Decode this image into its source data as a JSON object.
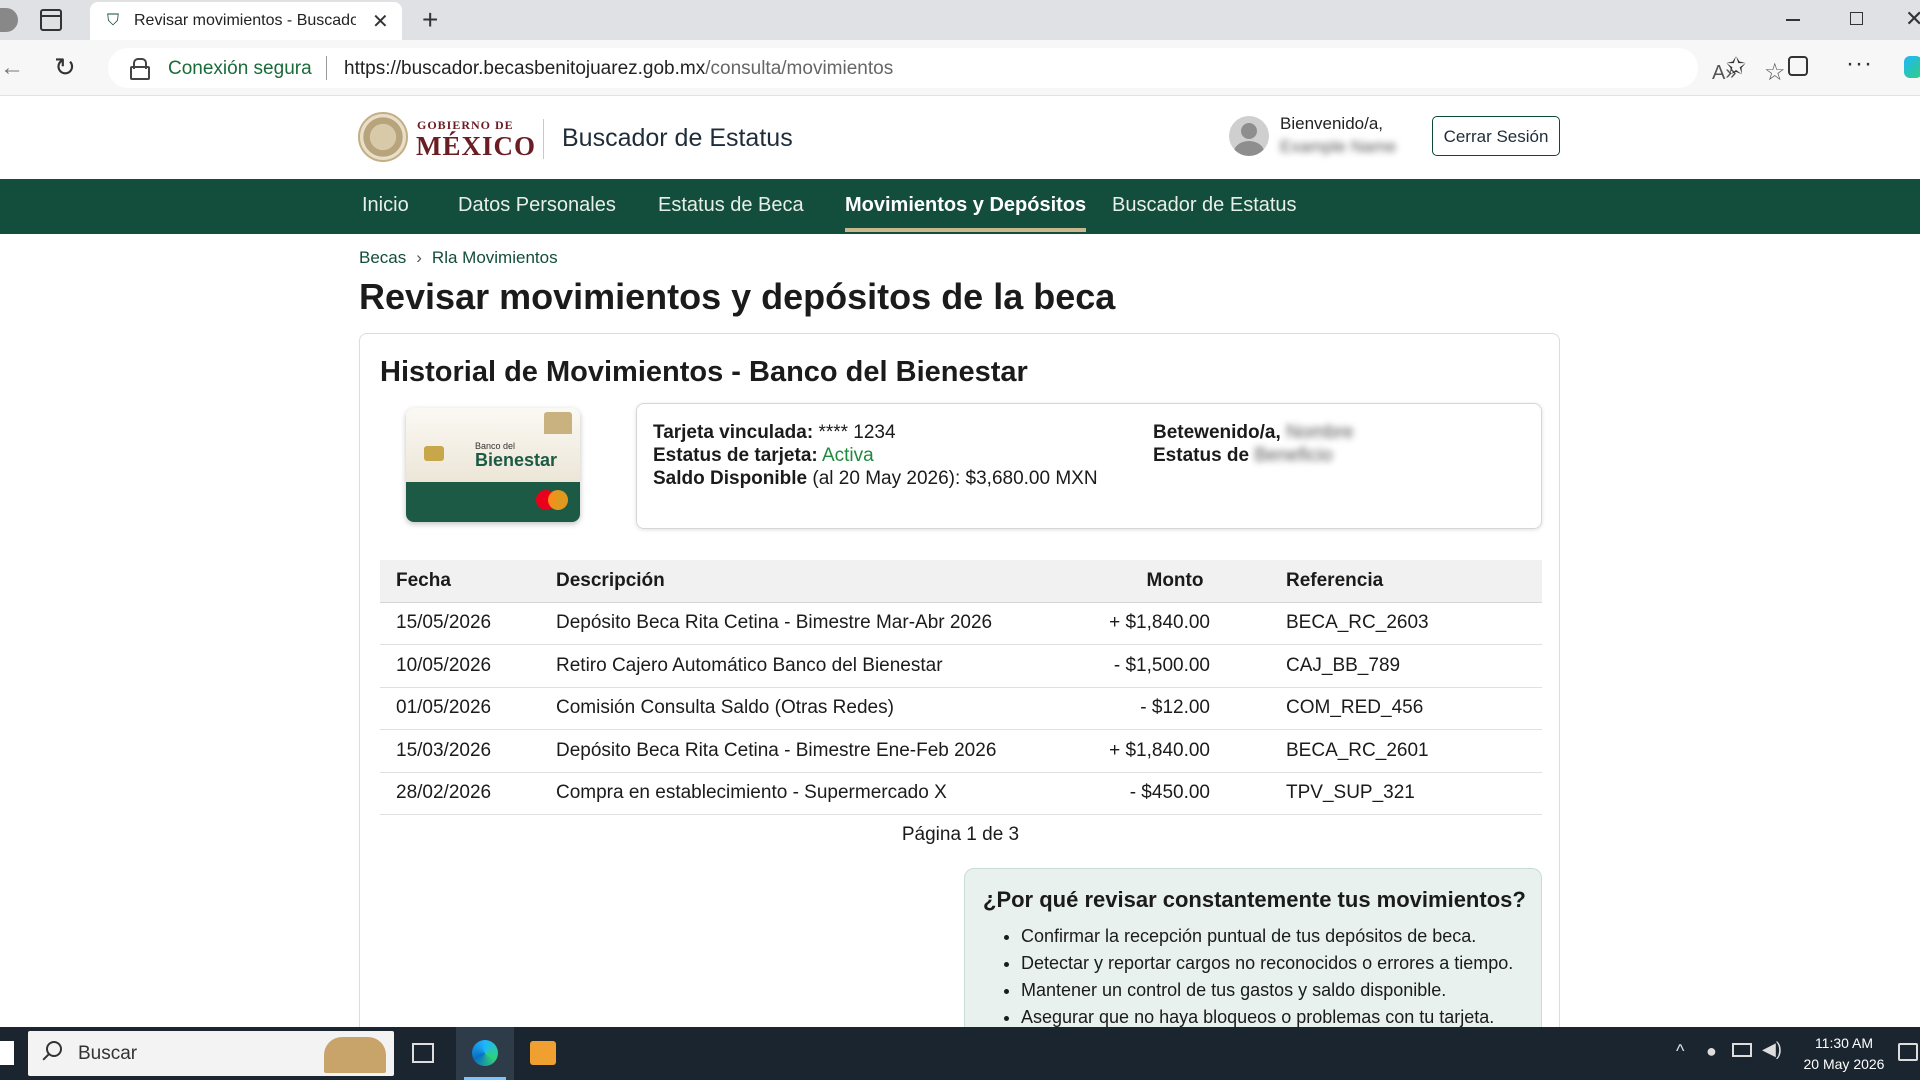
{
  "browser": {
    "tab_title": "Revisar movimientos - Buscador de Estatus",
    "secure_label": "Conexión segura",
    "url_host": "https://buscador.becasbenitojuarez.gob.mx",
    "url_path": "/consulta/movimientos"
  },
  "header": {
    "logo_small": "GOBIERNO DE",
    "logo_big": "MÉXICO",
    "site_title": "Buscador de Estatus",
    "welcome_label": "Bienvenido/a,",
    "welcome_name": "Example Name",
    "logout_label": "Cerrar Sesión"
  },
  "nav": {
    "items": [
      {
        "label": "Inicio"
      },
      {
        "label": "Datos Personales"
      },
      {
        "label": "Estatus de Beca"
      },
      {
        "label": "Movimientos y Depósitos",
        "active": true
      },
      {
        "label": "Buscador de Estatus"
      }
    ]
  },
  "breadcrumb": {
    "items": [
      "Becas",
      "Rla Movimientos"
    ],
    "separator": "›"
  },
  "page": {
    "title": "Revisar movimientos y depósitos de la beca"
  },
  "history": {
    "title": "Historial de Movimientos - Banco del Bienestar",
    "card_image": {
      "small_text": "Banco del",
      "name": "Bienestar"
    },
    "info": {
      "card_label": "Tarjeta vinculada:",
      "card_value": "**** 1234",
      "status_label": "Estatus de tarjeta:",
      "status_value": "Activa",
      "balance_label": "Saldo Disponible",
      "balance_value": "(al 20 May 2026): $3,680.00 MXN",
      "welcome_label": "Betewenido/a,",
      "welcome_value": "Nombre",
      "beca_status_label": "Estatus de",
      "beca_status_value": "Beneficio"
    },
    "table": {
      "headers": [
        "Fecha",
        "Descripción",
        "Monto",
        "Referencia"
      ],
      "rows": [
        {
          "date": "15/05/2026",
          "desc": "Depósito Beca Rita Cetina - Bimestre Mar-Abr 2026",
          "amount": "+ $1,840.00",
          "ref": "BECA_RC_2603"
        },
        {
          "date": "10/05/2026",
          "desc": "Retiro Cajero Automático Banco del Bienestar",
          "amount": "- $1,500.00",
          "ref": "CAJ_BB_789"
        },
        {
          "date": "01/05/2026",
          "desc": "Comisión Consulta Saldo (Otras Redes)",
          "amount": "- $12.00",
          "ref": "COM_RED_456"
        },
        {
          "date": "15/03/2026",
          "desc": "Depósito Beca Rita Cetina - Bimestre Ene-Feb 2026",
          "amount": "+ $1,840.00",
          "ref": "BECA_RC_2601"
        },
        {
          "date": "28/02/2026",
          "desc": "Compra en establecimiento - Supermercado X",
          "amount": "- $450.00",
          "ref": "TPV_SUP_321"
        }
      ]
    },
    "pagination": "Página 1 de 3"
  },
  "tips": {
    "title": "¿Por qué revisar constantemente tus movimientos?",
    "items": [
      "Confirmar la recepción puntual de tus depósitos de beca.",
      "Detectar y reportar cargos no reconocidos o errores a tiempo.",
      "Mantener un control de tus gastos y saldo disponible.",
      "Asegurar que no haya bloqueos o problemas con tu tarjeta."
    ]
  },
  "taskbar": {
    "search_placeholder": "Buscar",
    "time": "11:30 AM",
    "date": "20 May 2026"
  },
  "colors": {
    "nav_green": "#134d3b",
    "positive_amount": "#1f8a3e",
    "logo_maroon": "#6b1d24",
    "nav_active_underline": "#c9b88d"
  }
}
